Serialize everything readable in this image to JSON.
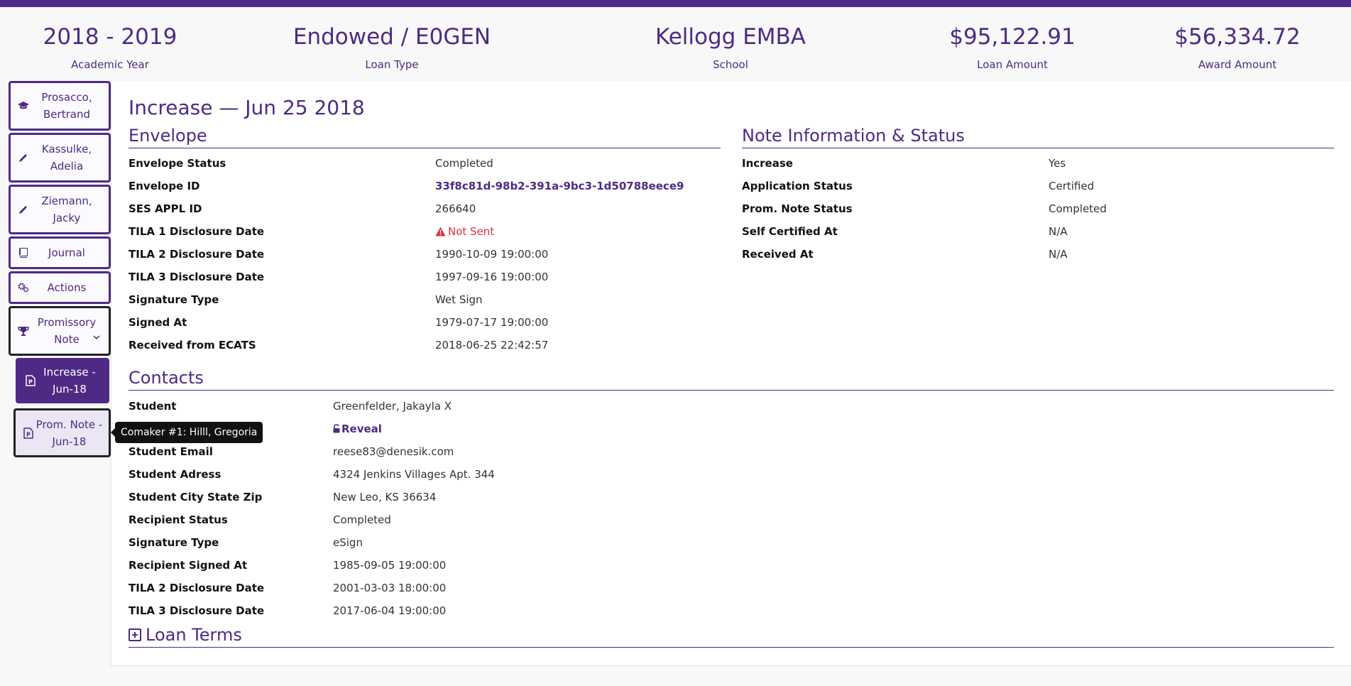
{
  "summary": [
    {
      "value": "2018 - 2019",
      "label": "Academic Year"
    },
    {
      "value": "Endowed / E0GEN",
      "label": "Loan Type"
    },
    {
      "value": "Kellogg EMBA",
      "label": "School"
    },
    {
      "value": "$95,122.91",
      "label": "Loan Amount"
    },
    {
      "value": "$56,334.72",
      "label": "Award Amount"
    }
  ],
  "sidebar": {
    "items": [
      {
        "label": "Prosacco, Bertrand",
        "icon": "graduation-cap-icon"
      },
      {
        "label": "Kassulke, Adelia",
        "icon": "pencil-icon"
      },
      {
        "label": "Ziemann, Jacky",
        "icon": "pencil-icon"
      },
      {
        "label": "Journal",
        "icon": "book-icon"
      },
      {
        "label": "Actions",
        "icon": "gears-icon"
      },
      {
        "label": "Promissory Note",
        "icon": "trophy-icon"
      },
      {
        "label": "Increase - Jun-18",
        "icon": "file-p-icon"
      },
      {
        "label": "Prom. Note - Jun-18",
        "icon": "file-p-icon"
      }
    ],
    "tooltip": "Comaker #1: Hilll, Gregoria"
  },
  "main": {
    "title": "Increase — Jun 25 2018",
    "envelope": {
      "title": "Envelope",
      "rows": [
        {
          "label": "Envelope Status",
          "value": "Completed"
        },
        {
          "label": "Envelope ID",
          "value": "33f8c81d-98b2-391a-9bc3-1d50788eece9"
        },
        {
          "label": "SES APPL ID",
          "value": "266640"
        },
        {
          "label": "TILA 1 Disclosure Date",
          "value": "Not Sent"
        },
        {
          "label": "TILA 2 Disclosure Date",
          "value": "1990-10-09 19:00:00"
        },
        {
          "label": "TILA 3 Disclosure Date",
          "value": "1997-09-16 19:00:00"
        },
        {
          "label": "Signature Type",
          "value": "Wet Sign"
        },
        {
          "label": "Signed At",
          "value": "1979-07-17 19:00:00"
        },
        {
          "label": "Received from ECATS",
          "value": "2018-06-25 22:42:57"
        }
      ]
    },
    "note_info": {
      "title": "Note Information & Status",
      "rows": [
        {
          "label": "Increase",
          "value": "Yes"
        },
        {
          "label": "Application Status",
          "value": "Certified"
        },
        {
          "label": "Prom. Note Status",
          "value": "Completed"
        },
        {
          "label": "Self Certified At",
          "value": "N/A"
        },
        {
          "label": "Received At",
          "value": "N/A"
        }
      ]
    },
    "contacts": {
      "title": "Contacts",
      "rows": [
        {
          "label": "Student",
          "value": "Greenfelder, Jakayla X"
        },
        {
          "label": "",
          "value": "Reveal"
        },
        {
          "label": "Student Email",
          "value": "reese83@denesik.com"
        },
        {
          "label": "Student Adress",
          "value": "4324 Jenkins Villages Apt. 344"
        },
        {
          "label": "Student City State Zip",
          "value": "New Leo, KS 36634"
        },
        {
          "label": "Recipient Status",
          "value": "Completed"
        },
        {
          "label": "Signature Type",
          "value": "eSign"
        },
        {
          "label": "Recipient Signed At",
          "value": "1985-09-05 19:00:00"
        },
        {
          "label": "TILA 2 Disclosure Date",
          "value": "2001-03-03 18:00:00"
        },
        {
          "label": "TILA 3 Disclosure Date",
          "value": "2017-06-04 19:00:00"
        }
      ]
    },
    "loan_terms": {
      "title": "Loan Terms"
    }
  },
  "colors": {
    "brand": "#4e2a84",
    "warning": "#d9343a"
  }
}
